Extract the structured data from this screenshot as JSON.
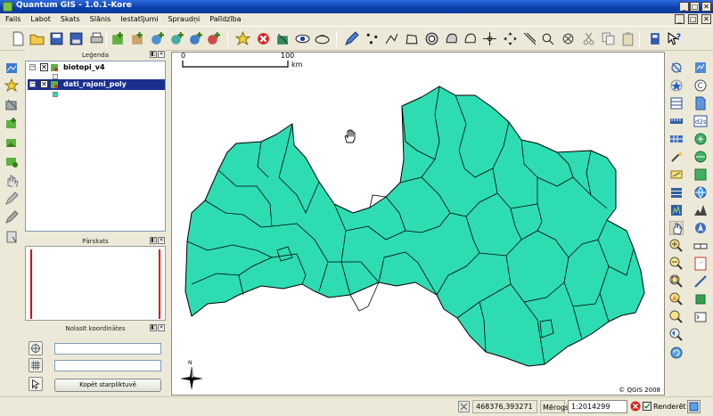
{
  "window": {
    "title": "Quantum GIS - 1.0.1-Kore",
    "minimize": "_",
    "maximize": "□",
    "close": "✕"
  },
  "menu": {
    "items": [
      "Fails",
      "Labot",
      "Skats",
      "Slānis",
      "Iestatījumi",
      "Spraudņi",
      "Palīdzība"
    ],
    "controls": [
      "_",
      "□",
      "✕"
    ]
  },
  "legend": {
    "title": "Leģenda",
    "layers": [
      {
        "name": "biotopi_v4",
        "checked": "✕",
        "selected": false,
        "expander": "−"
      },
      {
        "name": "dati_rajoni_poly",
        "checked": "✕",
        "selected": true,
        "expander": "−"
      }
    ],
    "swatch_color": "#2edcb2"
  },
  "overview": {
    "title": "Pārskats"
  },
  "coordinates_panel": {
    "title": "Nolasīt koordinātes",
    "copy_button": "Kopēt starpliktuvē"
  },
  "map": {
    "scale_start": "0",
    "scale_end": "100",
    "scale_unit": "km",
    "north_label": "N",
    "copyright": "© QGIS 2008",
    "fill_color": "#2edcb2"
  },
  "status": {
    "coordinates": "468376,393271",
    "scale_label": "Mērogs",
    "scale_value": "1:2014299",
    "render_label": "Renderēt"
  },
  "colors": {
    "titlebar": "#0a3ea8",
    "selection": "#1b2f8f",
    "background": "#ece9d8"
  }
}
